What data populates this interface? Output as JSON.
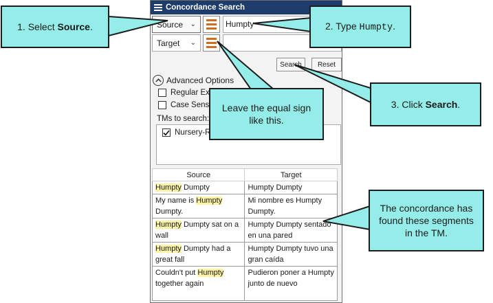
{
  "window": {
    "title": "Concordance Search"
  },
  "search": {
    "source_dropdown": "Source",
    "target_dropdown": "Target",
    "source_value": "Humpty",
    "target_value": "",
    "search_button": "Search",
    "reset_button": "Reset"
  },
  "advanced": {
    "label": "Advanced Options",
    "regular_expressions": "Regular Ex",
    "case_sensitive": "Case Sensi",
    "tms_label": "TMs to search:",
    "tm_item": "Nursery-R"
  },
  "results": {
    "headers": [
      "Source",
      "Target"
    ],
    "highlight": "Humpty",
    "rows": [
      {
        "source_pre": "",
        "source_hl": "Humpty",
        "source_post": " Dumpty",
        "target": "Humpty Dumpty"
      },
      {
        "source_pre": "My name is ",
        "source_hl": "Humpty",
        "source_post": " Dumpty.",
        "target": "Mi nombre es Humpty Dumpty."
      },
      {
        "source_pre": "",
        "source_hl": "Humpty",
        "source_post": " Dumpty sat on a wall",
        "target": "Humpty Dumpty sentado en una pared"
      },
      {
        "source_pre": "",
        "source_hl": "Humpty",
        "source_post": " Dumpty had a great fall",
        "target": "Humpty Dumpty tuvo una gran caída"
      },
      {
        "source_pre": "Couldn't put ",
        "source_hl": "Humpty",
        "source_post": " together again",
        "target": "Pudieron poner a Humpty junto de nuevo"
      }
    ]
  },
  "callouts": {
    "c1_pre": "1. Select ",
    "c1_bold": "Source",
    "c1_post": ".",
    "c2_pre": "2. Type ",
    "c2_code": "Humpty",
    "c2_post": ".",
    "c3_pre": "3. Click ",
    "c3_bold": "Search",
    "c3_post": ".",
    "c4": "Leave the equal sign like this.",
    "c5": "The concordance has found these segments in the TM."
  },
  "colors": {
    "callout_fill": "#94ede9",
    "titlebar": "#1d3b6b",
    "equal_icon": "#d36b1d",
    "highlight": "#fbf3a6"
  }
}
